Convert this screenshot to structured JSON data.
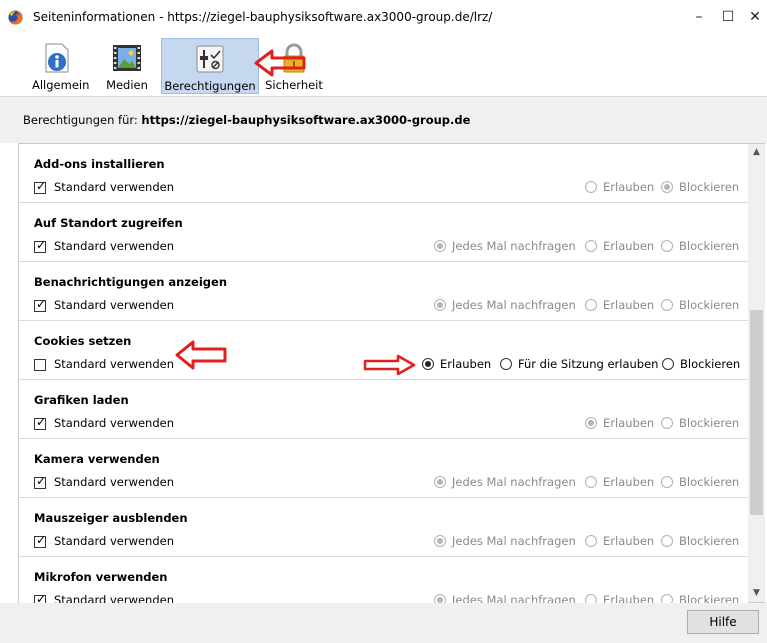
{
  "window": {
    "title": "Seiteninformationen - https://ziegel-bauphysiksoftware.ax3000-group.de/lrz/",
    "controls": {
      "minimize": "–",
      "maximize": "☐",
      "close": "✕"
    }
  },
  "tabs": [
    {
      "label": "Allgemein",
      "icon": "info-icon"
    },
    {
      "label": "Medien",
      "icon": "media-icon"
    },
    {
      "label": "Berechtigungen",
      "icon": "permissions-icon",
      "active": true
    },
    {
      "label": "Sicherheit",
      "icon": "lock-icon"
    }
  ],
  "permissions_for": {
    "label": "Berechtigungen für:",
    "host": "https://ziegel-bauphysiksoftware.ax3000-group.de"
  },
  "labels": {
    "use_default": "Standard verwenden",
    "ask": "Jedes Mal nachfragen",
    "allow": "Erlauben",
    "session": "Für die Sitzung erlauben",
    "block": "Blockieren"
  },
  "sections": [
    {
      "title": "Add-ons installieren",
      "default_checked": true,
      "selected": "block"
    },
    {
      "title": "Auf Standort zugreifen",
      "default_checked": true,
      "selected": "ask"
    },
    {
      "title": "Benachrichtigungen anzeigen",
      "default_checked": true,
      "selected": "ask"
    },
    {
      "title": "Cookies setzen",
      "default_checked": false,
      "selected": "allow"
    },
    {
      "title": "Grafiken laden",
      "default_checked": true,
      "selected": "allow"
    },
    {
      "title": "Kamera verwenden",
      "default_checked": true,
      "selected": "ask"
    },
    {
      "title": "Mauszeiger ausblenden",
      "default_checked": true,
      "selected": "ask"
    },
    {
      "title": "Mikrofon verwenden",
      "default_checked": true,
      "selected": "ask"
    }
  ],
  "footer": {
    "help_label": "Hilfe"
  },
  "colors": {
    "annotation_arrow": "#e02020",
    "active_tab": "#c5d8ef"
  }
}
